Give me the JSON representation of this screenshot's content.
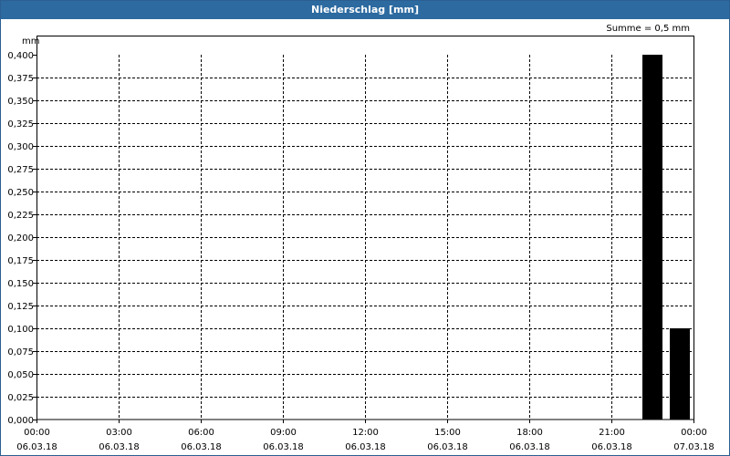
{
  "window": {
    "title": "Niederschlag [mm]"
  },
  "chart_data": {
    "type": "bar",
    "title": "Niederschlag [mm]",
    "ylabel": "mm",
    "annotation": "Summe = 0,5 mm",
    "ylim": [
      0,
      0.4
    ],
    "yticks": [
      "0,000",
      "0,025",
      "0,050",
      "0,075",
      "0,100",
      "0,125",
      "0,150",
      "0,175",
      "0,200",
      "0,225",
      "0,250",
      "0,275",
      "0,300",
      "0,325",
      "0,350",
      "0,375",
      "0,400"
    ],
    "xlim_hours": [
      0,
      24
    ],
    "xticks": [
      {
        "time": "00:00",
        "date": "06.03.18",
        "h": 0
      },
      {
        "time": "03:00",
        "date": "06.03.18",
        "h": 3
      },
      {
        "time": "06:00",
        "date": "06.03.18",
        "h": 6
      },
      {
        "time": "09:00",
        "date": "06.03.18",
        "h": 9
      },
      {
        "time": "12:00",
        "date": "06.03.18",
        "h": 12
      },
      {
        "time": "15:00",
        "date": "06.03.18",
        "h": 15
      },
      {
        "time": "18:00",
        "date": "06.03.18",
        "h": 18
      },
      {
        "time": "21:00",
        "date": "06.03.18",
        "h": 21
      },
      {
        "time": "00:00",
        "date": "07.03.18",
        "h": 24
      }
    ],
    "bars": [
      {
        "start": "22:00",
        "end": "23:00",
        "value": 0.4
      },
      {
        "start": "23:00",
        "end": "00:00",
        "value": 0.1
      }
    ],
    "bar_color": "#000000",
    "grid": true,
    "grid_style": "dashed"
  }
}
